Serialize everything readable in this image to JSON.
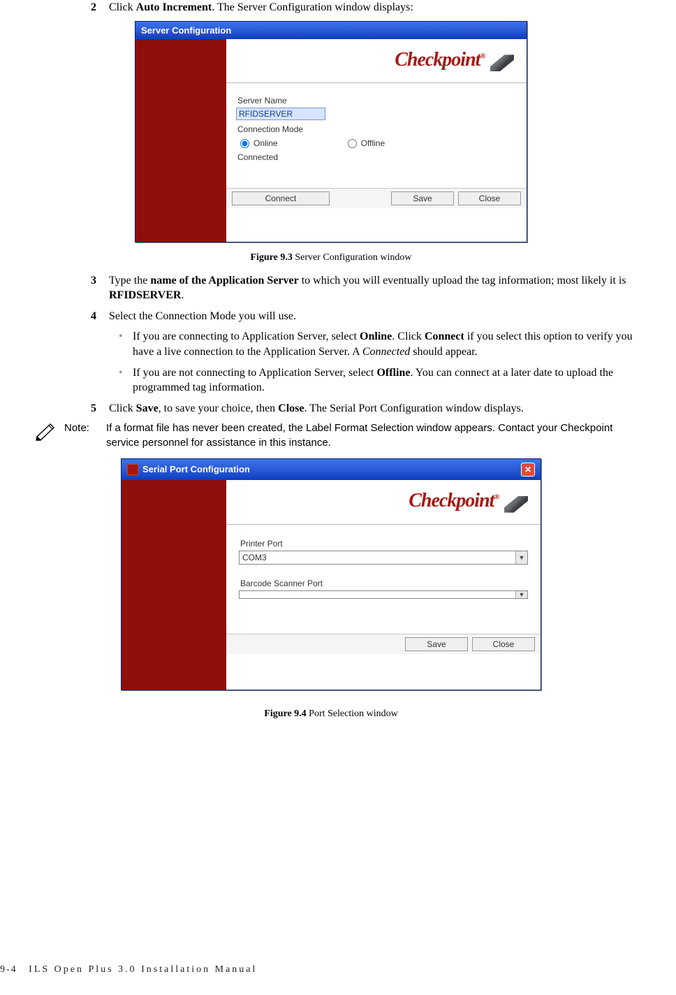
{
  "steps": {
    "s2": {
      "num": "2",
      "pre": "Click ",
      "bold1": "Auto Increment",
      "post": ". The Server Configuration window displays:"
    },
    "s3": {
      "num": "3",
      "pre": "Type the ",
      "bold1": "name of the Application Server",
      "mid": " to which you will eventually upload the tag information; most likely it is ",
      "bold2": "RFIDSERVER",
      "post": "."
    },
    "s4": {
      "num": "4",
      "text": "Select the Connection Mode you will use."
    },
    "s4b1": {
      "pre": "If you are connecting to Application Server, select ",
      "b1": "Online",
      "mid1": ". Click ",
      "b2": "Connect",
      "mid2": " if you select this option to verify you have a live connection to the Application Server. A ",
      "ital": "Connected",
      "post": " should appear."
    },
    "s4b2": {
      "pre": "If you are not connecting to Application Server, select ",
      "b1": "Offline",
      "post": ". You can connect at a later date to upload the programmed tag information."
    },
    "s5": {
      "num": "5",
      "pre": "Click ",
      "b1": "Save",
      "mid": ", to save your choice, then ",
      "b2": "Close",
      "post": ". The Serial Port Configuration window displays."
    }
  },
  "note": {
    "label": "Note:",
    "text": "If a format file has never been created, the Label Format Selection window appears. Contact your Checkpoint service personnel for assistance in this instance."
  },
  "fig1": {
    "caption_bold": "Figure 9.3",
    "caption_rest": " Server Configuration window",
    "window_title": "Server Configuration",
    "logo": "Checkpoint",
    "server_name_label": "Server Name",
    "server_name_value": "RFIDSERVER",
    "conn_mode_label": "Connection Mode",
    "online_label": "Online",
    "offline_label": "Offline",
    "connected_label": "Connected",
    "connect_btn": "Connect",
    "save_btn": "Save",
    "close_btn": "Close"
  },
  "fig2": {
    "caption_bold": "Figure 9.4",
    "caption_rest": " Port Selection window",
    "window_title": "Serial Port Configuration",
    "logo": "Checkpoint",
    "printer_label": "Printer Port",
    "printer_value": "COM3",
    "scanner_label": "Barcode Scanner Port",
    "scanner_value": "",
    "save_btn": "Save",
    "close_btn": "Close"
  },
  "footer": {
    "page": "9-4",
    "title": "ILS Open Plus 3.0 Installation Manual"
  }
}
